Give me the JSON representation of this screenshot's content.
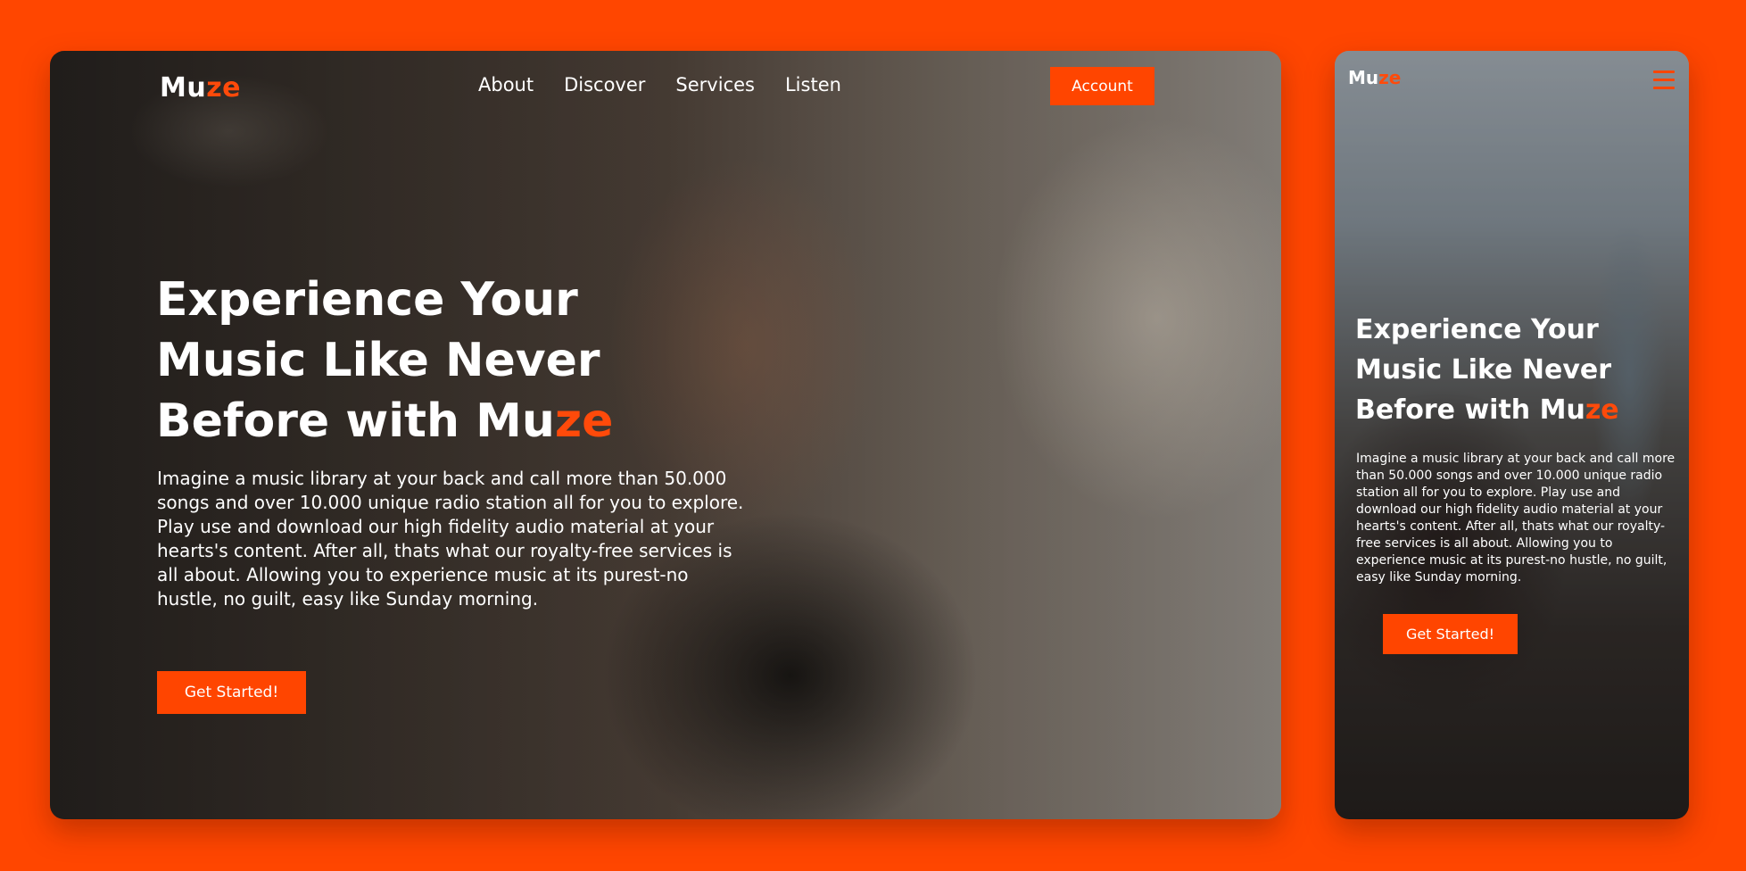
{
  "brand": {
    "logo_main": "Mu",
    "logo_accent": "ze",
    "accent_color": "#ff4500",
    "background_color": "#ff4600"
  },
  "desktop": {
    "nav": [
      "About",
      "Discover",
      "Services",
      "Listen"
    ],
    "account_label": "Account",
    "hero": {
      "title_line1": "Experience Your",
      "title_line2": "Music Like Never",
      "title_line3_main": "Before with Mu",
      "title_line3_accent": "ze",
      "description": "Imagine a music library at your back and call more than 50.000 songs and over 10.000 unique radio station all for you to explore. Play use and download our high fidelity audio material at your hearts's content. After all, thats what our royalty-free services is all about. Allowing you to experience music at its purest-no hustle, no guilt, easy like Sunday morning.",
      "cta_label": "Get Started!"
    }
  },
  "mobile": {
    "menu_icon": "hamburger-menu-icon",
    "hero": {
      "title_line1": "Experience Your",
      "title_line2": "Music Like Never",
      "title_line3_main": "Before with Mu",
      "title_line3_accent": "ze",
      "description": "Imagine a music library at your back and call more than 50.000 songs and over 10.000 unique radio station all for you to explore. Play use and download our high fidelity audio material at your hearts's content. After all, thats what our royalty-free services is all about. Allowing you to experience music at its purest-no hustle, no guilt, easy like Sunday morning.",
      "cta_label": "Get Started!"
    }
  }
}
